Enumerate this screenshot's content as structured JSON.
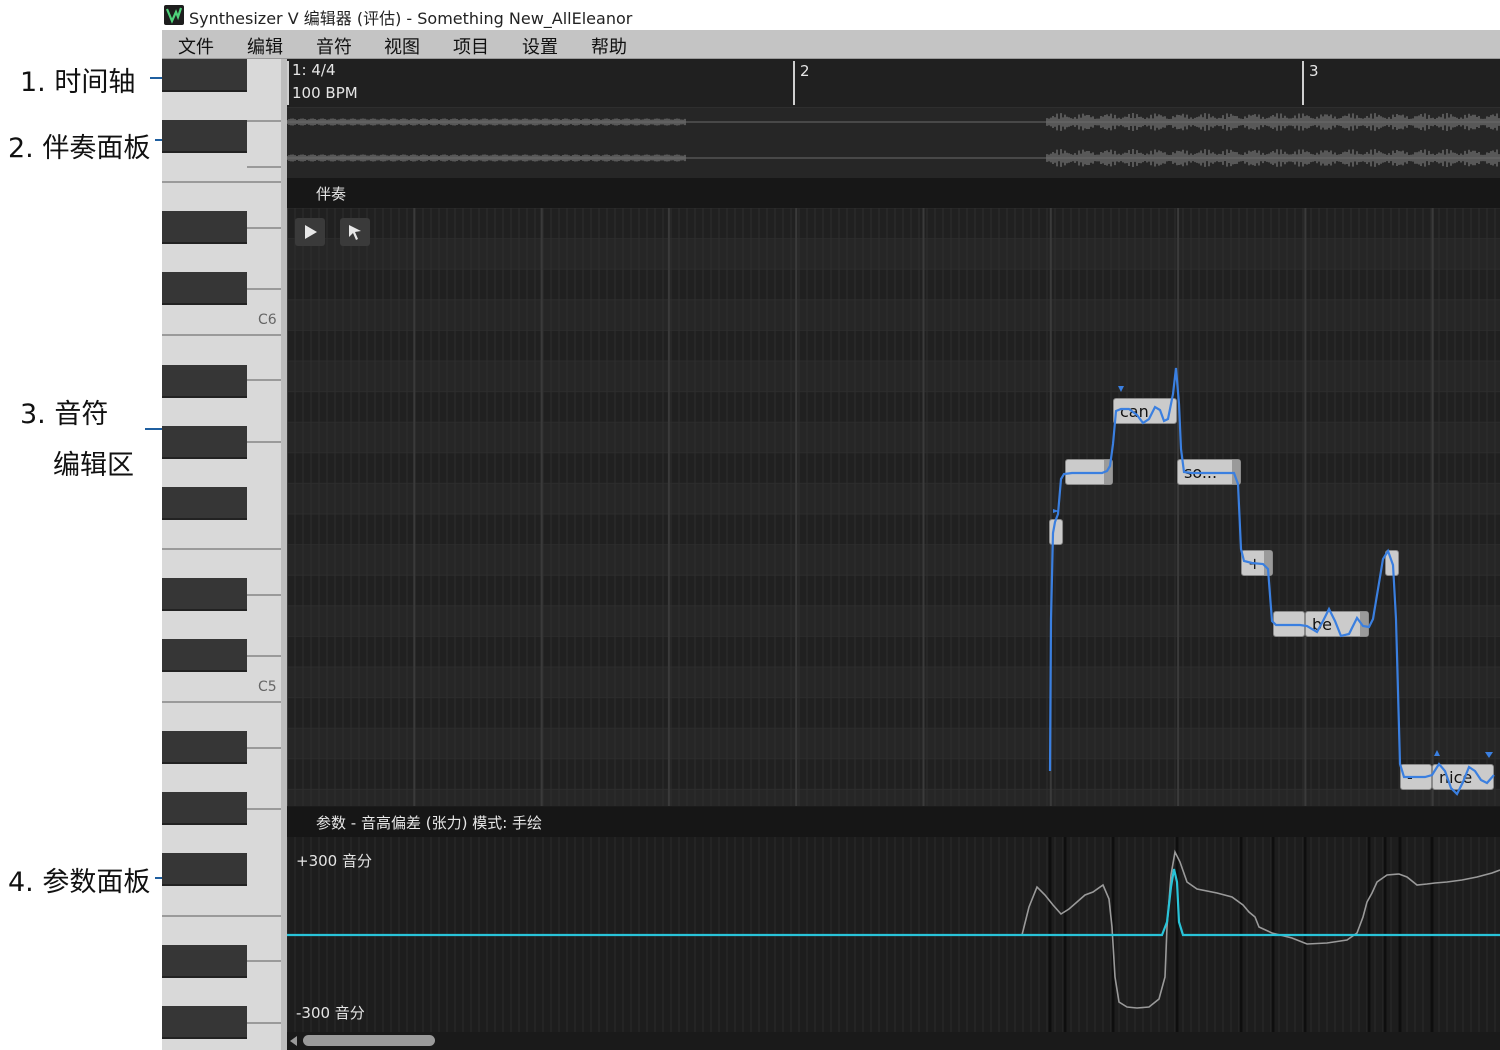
{
  "annotations": [
    {
      "label": "1. 时间轴"
    },
    {
      "label": "2. 伴奏面板"
    },
    {
      "label": "3. 音符"
    },
    {
      "label": "编辑区"
    },
    {
      "label": "4. 参数面板"
    }
  ],
  "window": {
    "title": "Synthesizer V 编辑器 (评估) - Something New_AllEleanor",
    "logo_icon": "synthesizer-v-logo"
  },
  "menu": [
    "文件",
    "编辑",
    "音符",
    "视图",
    "项目",
    "设置",
    "帮助"
  ],
  "piano": {
    "c6_label": "C6",
    "c5_label": "C5"
  },
  "timeline": {
    "time_signature": "1: 4/4",
    "tempo": "100 BPM",
    "bar2": "2",
    "bar3": "3"
  },
  "accompaniment": {
    "header": "伴奏"
  },
  "tools": {
    "play_icon": "play-icon",
    "select_icon": "pointer-arrow-icon"
  },
  "notes": [
    {
      "lyric": ""
    },
    {
      "lyric": ""
    },
    {
      "lyric": "can"
    },
    {
      "lyric": "so..."
    },
    {
      "lyric": "+"
    },
    {
      "lyric": "-"
    },
    {
      "lyric": "be"
    },
    {
      "lyric": ""
    },
    {
      "lyric": "-"
    },
    {
      "lyric": "nice"
    }
  ],
  "parameters": {
    "header": "参数  -  音高偏差 (张力) 模式: 手绘",
    "max_label": "+300 音分",
    "min_label": "-300 音分"
  },
  "colors": {
    "pitch_curve": "#3a7fe0",
    "param_curve": "#29c3d8",
    "annotation_line": "#1f5fa0"
  }
}
